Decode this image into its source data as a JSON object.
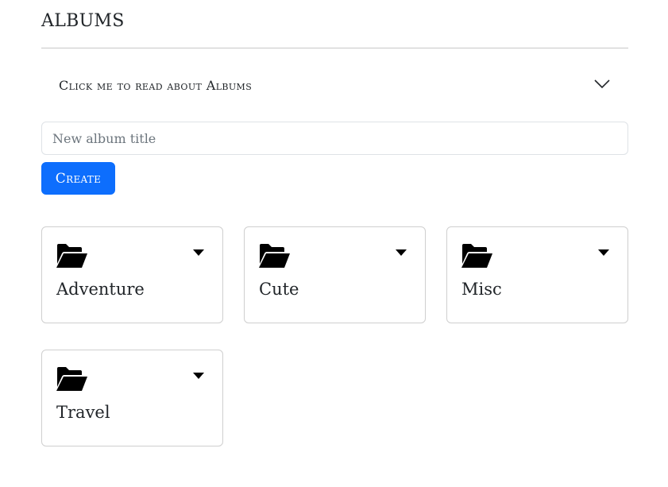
{
  "header": {
    "title": "ALBUMS"
  },
  "accordion": {
    "label": "Click me to read about Albums",
    "icon": "chevron-down-icon"
  },
  "form": {
    "placeholder": "New album title",
    "value": "",
    "create_label": "Create"
  },
  "albums": [
    {
      "name": "Adventure",
      "icon": "folder-open-icon",
      "menu_icon": "caret-down-icon"
    },
    {
      "name": "Cute",
      "icon": "folder-open-icon",
      "menu_icon": "caret-down-icon"
    },
    {
      "name": "Misc",
      "icon": "folder-open-icon",
      "menu_icon": "caret-down-icon"
    },
    {
      "name": "Travel",
      "icon": "folder-open-icon",
      "menu_icon": "caret-down-icon"
    }
  ],
  "colors": {
    "primary": "#0d6efd",
    "text": "#212529",
    "border": "#cfcfcf"
  }
}
